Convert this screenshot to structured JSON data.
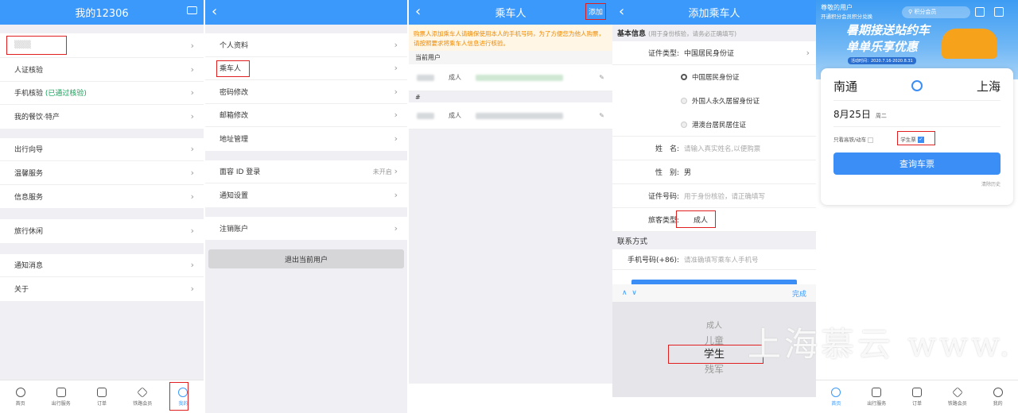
{
  "colors": {
    "primary": "#3b99fc",
    "highlight": "#e02020",
    "notice": "#f08a00",
    "verified": "#16a35a"
  },
  "panel1": {
    "title": "我的12306",
    "top_icon": "message-icon",
    "user_name": "▒▒▒",
    "groups": [
      [
        {
          "label": "人证核验"
        },
        {
          "label": "手机核验",
          "extra": "(已通过核验)"
        },
        {
          "label": "我的餐饮·特产"
        }
      ],
      [
        {
          "label": "出行向导"
        },
        {
          "label": "温馨服务"
        },
        {
          "label": "信息服务"
        }
      ],
      [
        {
          "label": "旅行休闲"
        }
      ],
      [
        {
          "label": "通知消息"
        },
        {
          "label": "关于"
        }
      ]
    ],
    "tabs": [
      {
        "label": "首页",
        "icon": "home-icon"
      },
      {
        "label": "出行服务",
        "icon": "travel-icon"
      },
      {
        "label": "订单",
        "icon": "order-icon"
      },
      {
        "label": "铁路会员",
        "icon": "member-icon"
      },
      {
        "label": "我的",
        "icon": "user-icon"
      }
    ]
  },
  "panel2": {
    "groups": [
      [
        {
          "label": "个人资料"
        },
        {
          "label": "乘车人"
        },
        {
          "label": "密码修改"
        },
        {
          "label": "邮箱修改"
        },
        {
          "label": "地址管理"
        }
      ],
      [
        {
          "label": "面容 ID 登录",
          "status": "未开启"
        },
        {
          "label": "通知设置"
        }
      ],
      [
        {
          "label": "注销账户"
        }
      ]
    ],
    "logout": "退出当前用户"
  },
  "panel3": {
    "title": "乘车人",
    "add": "添加",
    "notice": "购票人添加乘车人请确保使用本人的手机号码，为了方便您为他人购票，请按照要求将乘车人信息进行核验。",
    "current_user_label": "当前用户",
    "current_type": "成人",
    "other_label": "#",
    "other_type": "成人"
  },
  "panel4": {
    "title": "添加乘车人",
    "basic_info": "基本信息",
    "basic_hint": "(用于身份核验，请务必正确填写)",
    "id_type_label": "证件类型:",
    "id_type_value": "中国居民身份证",
    "id_options": [
      "中国居民身份证",
      "外国人永久居留身份证",
      "港澳台居民居住证"
    ],
    "name_label": "姓　名:",
    "name_placeholder": "请输入真实姓名,以便购票",
    "gender_label": "性　别:",
    "gender_value": "男",
    "id_no_label": "证件号码:",
    "id_no_placeholder": "用于身份核验，请正确填写",
    "passenger_type_label": "旅客类型:",
    "passenger_type_value": "成人",
    "contact_header": "联系方式",
    "phone_label": "手机号码(+86):",
    "phone_placeholder": "请准确填写乘车人手机号",
    "done": "完成",
    "picker_options": [
      "成人",
      "儿童",
      "学生",
      "残军"
    ],
    "picker_selected": 2
  },
  "panel5": {
    "greeting": "尊敬的用户",
    "sub_greeting": "开通积分会员积分兑换",
    "search_label": "积分会员",
    "banner_line1": "暑期接送站约车",
    "banner_line2": "单单乐享优惠",
    "banner_date": "活动时间：2020.7.16-2020.8.31",
    "from": "南通",
    "to": "上海",
    "date": "8月25日",
    "weekday": "周二",
    "gaotie_label": "只看高铁/动车",
    "student_label": "学生票",
    "query": "查询车票",
    "clear_history": "清除历史",
    "tabs": [
      {
        "label": "首页",
        "icon": "home-icon"
      },
      {
        "label": "出行服务",
        "icon": "travel-icon"
      },
      {
        "label": "订单",
        "icon": "order-icon"
      },
      {
        "label": "铁路会员",
        "icon": "member-icon"
      },
      {
        "label": "我的",
        "icon": "user-icon"
      }
    ]
  },
  "watermark": "上海慕云 www."
}
